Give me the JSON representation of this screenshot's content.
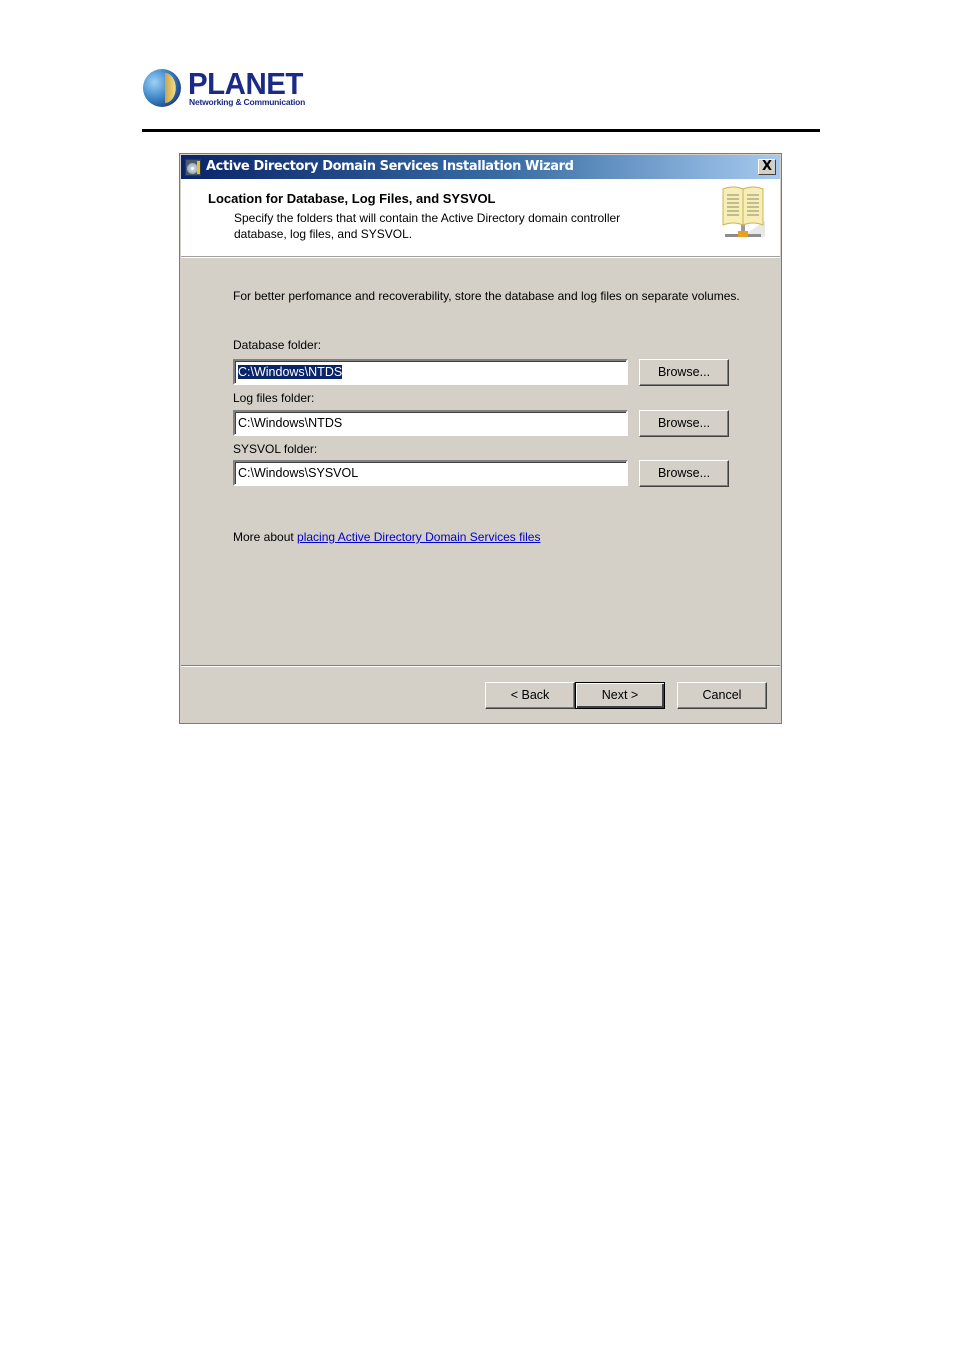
{
  "page": {
    "logo": {
      "name": "PLANET",
      "tagline": "Networking & Communication"
    }
  },
  "dialog": {
    "title": "Active Directory Domain Services Installation Wizard",
    "close_label": "X",
    "header": {
      "title": "Location for Database, Log Files, and SYSVOL",
      "description": "Specify the folders that will contain the Active Directory domain controller database, log files, and SYSVOL."
    },
    "intro": "For better perfomance and recoverability, store the database and log files on separate volumes.",
    "fields": [
      {
        "label": "Database folder:",
        "value": "C:\\Windows\\NTDS",
        "selected": true,
        "browse_label": "Browse..."
      },
      {
        "label": "Log files folder:",
        "value": "C:\\Windows\\NTDS",
        "selected": false,
        "browse_label": "Browse..."
      },
      {
        "label": "SYSVOL folder:",
        "value": "C:\\Windows\\SYSVOL",
        "selected": false,
        "browse_label": "Browse..."
      }
    ],
    "more": {
      "prefix": "More about",
      "link_text": "placing Active Directory Domain Services files"
    },
    "buttons": {
      "back": "< Back",
      "next": "Next >",
      "cancel": "Cancel"
    }
  }
}
